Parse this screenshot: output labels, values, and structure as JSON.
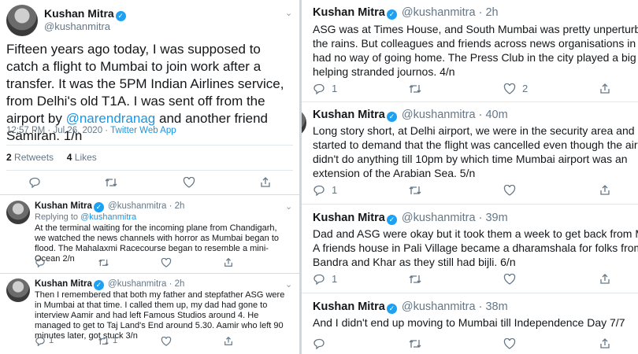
{
  "main_tweet": {
    "name": "Kushan Mitra",
    "handle": "@kushanmitra",
    "text_before": "Fifteen years ago today, I was supposed to catch a flight to Mumbai to join work after a transfer. It was the 5PM Indian Airlines service, from Delhi's old T1A. I was sent off from the airport by ",
    "mention": "@narendranag",
    "text_after": " and another friend Samiran. 1/n",
    "timestamp": "12:57 PM · Jul 26, 2020 · ",
    "source": "Twitter Web App",
    "retweets_count": "2",
    "retweets_label": "Retweets",
    "likes_count": "4",
    "likes_label": "Likes"
  },
  "left_replies": [
    {
      "name": "Kushan Mitra",
      "handle": "@kushanmitra",
      "dot": "·",
      "time": "2h",
      "replying_label": "Replying to ",
      "replying_handle": "@kushanmitra",
      "text": "At the terminal waiting for the incoming plane from Chandigarh, we watched the news channels with horror as Mumbai began to flood. The Mahalaxmi Racecourse began to resemble a mini-Ocean 2/n",
      "replies": "",
      "retweets": "",
      "likes": ""
    },
    {
      "name": "Kushan Mitra",
      "handle": "@kushanmitra",
      "dot": "·",
      "time": "2h",
      "text": "Then I remembered that both my father and stepfather ASG were in Mumbai at that time. I called them up, my dad had gone to interview Aamir and had left Famous Studios around 4. He managed to get to Taj Land's End around 5.30. Aamir who left 90 minutes later, got stuck 3/n",
      "replies": "1",
      "retweets": "1",
      "likes": ""
    }
  ],
  "right_tweets": [
    {
      "name": "Kushan Mitra",
      "handle": "@kushanmitra",
      "dot": "·",
      "time": "2h",
      "lines": [
        "ASG was at Times House, and South Mumbai was pretty unperturbed by",
        "the rains. But colleagues and friends across news organisations in the",
        "had no way of going home. The Press Club in the city played a big role",
        "helping stranded journos. 4/n"
      ],
      "replies": "1",
      "retweets": "",
      "likes": "2"
    },
    {
      "name": "Kushan Mitra",
      "handle": "@kushanmitra",
      "dot": "·",
      "time": "40m",
      "lines": [
        "Long story short, at Delhi airport, we were in the security area and p",
        "started to demand that the flight was cancelled even though the airline",
        "didn't do anything till 10pm by which time Mumbai airport was an",
        "extension of the Arabian Sea. 5/n"
      ],
      "replies": "1",
      "retweets": "",
      "likes": ""
    },
    {
      "name": "Kushan Mitra",
      "handle": "@kushanmitra",
      "dot": "·",
      "time": "39m",
      "lines": [
        "Dad and ASG were okay but it took them a week to get back from M",
        "A friends house in Pali Village became a dharamshala for folks from",
        "Bandra and Khar as they still had bijli. 6/n"
      ],
      "replies": "1",
      "retweets": "",
      "likes": ""
    },
    {
      "name": "Kushan Mitra",
      "handle": "@kushanmitra",
      "dot": "·",
      "time": "38m",
      "lines": [
        "And I didn't end up moving to Mumbai till Independence Day 7/7"
      ],
      "replies": "",
      "retweets": "",
      "likes": ""
    }
  ],
  "colors": {
    "link": "#1b95e0",
    "muted": "#657786",
    "verified": "#1da1f2"
  }
}
